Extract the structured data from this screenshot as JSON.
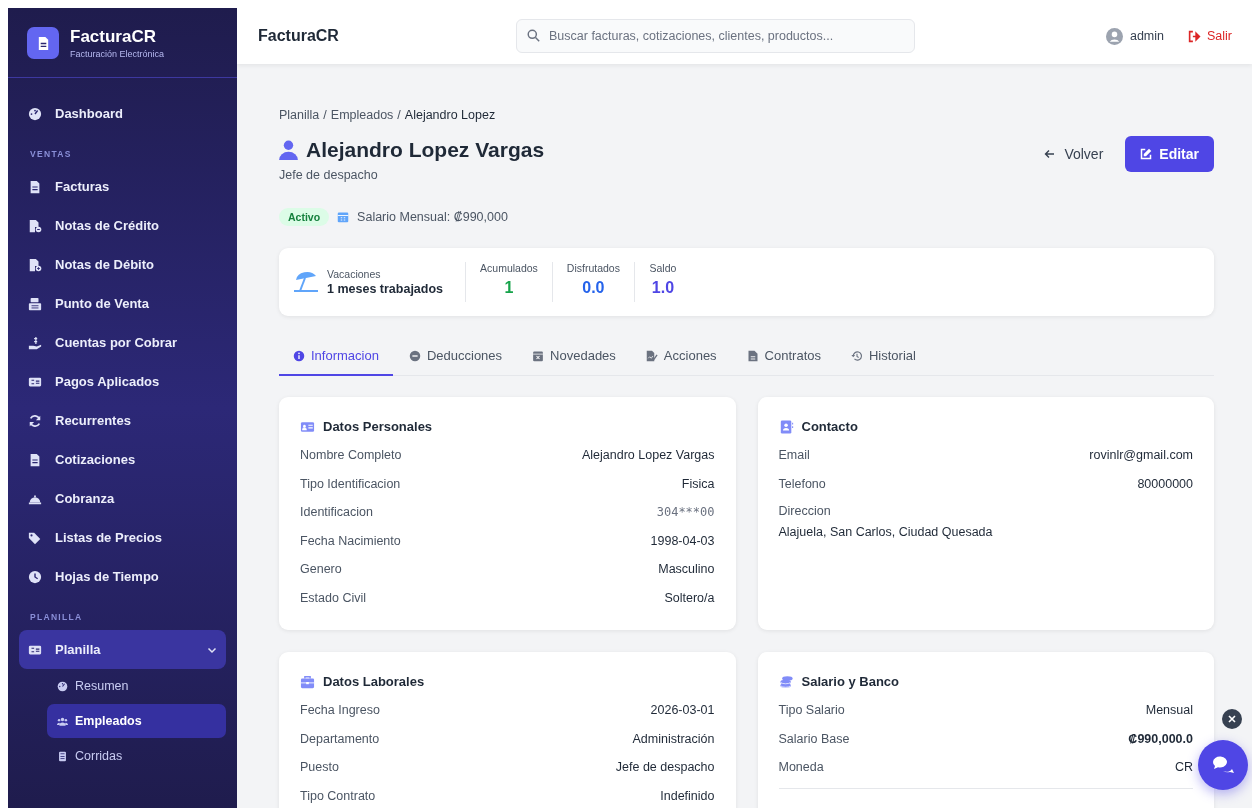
{
  "sidebar": {
    "brand_name": "FacturaCR",
    "brand_subtitle": "Facturación Electrónica",
    "items": [
      {
        "kind": "item",
        "label": "Dashboard",
        "selected": false
      },
      {
        "kind": "section",
        "label": "VENTAS"
      },
      {
        "kind": "item",
        "label": "Facturas",
        "selected": false
      },
      {
        "kind": "item",
        "label": "Notas de Crédito",
        "selected": false
      },
      {
        "kind": "item",
        "label": "Notas de Débito",
        "selected": false
      },
      {
        "kind": "item",
        "label": "Punto de Venta",
        "selected": false
      },
      {
        "kind": "item",
        "label": "Cuentas por Cobrar",
        "selected": false
      },
      {
        "kind": "item",
        "label": "Pagos Aplicados",
        "selected": false
      },
      {
        "kind": "item",
        "label": "Recurrentes",
        "selected": false
      },
      {
        "kind": "item",
        "label": "Cotizaciones",
        "selected": false
      },
      {
        "kind": "item",
        "label": "Cobranza",
        "selected": false
      },
      {
        "kind": "item",
        "label": "Listas de Precios",
        "selected": false
      },
      {
        "kind": "item",
        "label": "Hojas de Tiempo",
        "selected": false
      },
      {
        "kind": "section",
        "label": "PLANILLA"
      },
      {
        "kind": "group",
        "label": "Planilla",
        "selected": true,
        "expanded": true,
        "children": [
          {
            "label": "Resumen",
            "selected": false
          },
          {
            "label": "Empleados",
            "selected": true
          },
          {
            "label": "Corridas",
            "selected": false
          }
        ]
      }
    ]
  },
  "topbar": {
    "title": "FacturaCR",
    "search": {
      "placeholder": "Buscar facturas, cotizaciones, clientes, productos..."
    },
    "user": "admin",
    "logout": "Salir"
  },
  "breadcrumb": {
    "separator": "/",
    "items": [
      "Planilla",
      "Empleados",
      "Alejandro Lopez"
    ]
  },
  "employee": {
    "name": "Alejandro Lopez Vargas",
    "position": "Jefe de despacho",
    "status": "Activo",
    "salary": "Salario Mensual: ₡990,000"
  },
  "actions": {
    "back": "Volver",
    "edit": "Editar"
  },
  "vacations": {
    "label": "Vacaciones",
    "value": "1 meses trabajados",
    "stats": [
      {
        "label": "Acumulados",
        "value": "1",
        "color": "#16a34a"
      },
      {
        "label": "Disfrutados",
        "value": "0.0",
        "color": "#2563eb"
      },
      {
        "label": "Saldo",
        "value": "1.0",
        "color": "#4f46e5"
      }
    ]
  },
  "tabs": [
    {
      "label": "Informacion",
      "selected": true
    },
    {
      "label": "Deducciones",
      "selected": false
    },
    {
      "label": "Novedades",
      "selected": false
    },
    {
      "label": "Acciones",
      "selected": false
    },
    {
      "label": "Contratos",
      "selected": false
    },
    {
      "label": "Historial",
      "selected": false
    }
  ],
  "cards": [
    {
      "title": "Datos Personales",
      "rows": [
        {
          "kind": "text",
          "label": "Nombre Completo",
          "value": "Alejandro Lopez Vargas"
        },
        {
          "kind": "text",
          "label": "Tipo Identificacion",
          "value": "Fisica"
        },
        {
          "kind": "mono",
          "label": "Identificacion",
          "value": "304***00"
        },
        {
          "kind": "text",
          "label": "Fecha Nacimiento",
          "value": "1998-04-03"
        },
        {
          "kind": "text",
          "label": "Genero",
          "value": "Masculino"
        },
        {
          "kind": "text",
          "label": "Estado Civil",
          "value": "Soltero/a"
        }
      ]
    },
    {
      "title": "Contacto",
      "rows": [
        {
          "kind": "text",
          "label": "Email",
          "value": "rovinlr@gmail.com"
        },
        {
          "kind": "text",
          "label": "Telefono",
          "value": "80000000"
        },
        {
          "kind": "stacked",
          "label": "Direccion",
          "value": "Alajuela, San Carlos, Ciudad Quesada"
        }
      ]
    },
    {
      "title": "Datos Laborales",
      "rows": [
        {
          "kind": "text",
          "label": "Fecha Ingreso",
          "value": "2026-03-01"
        },
        {
          "kind": "text",
          "label": "Departamento",
          "value": "Administración"
        },
        {
          "kind": "text",
          "label": "Puesto",
          "value": "Jefe de despacho"
        },
        {
          "kind": "text",
          "label": "Tipo Contrato",
          "value": "Indefinido"
        }
      ]
    },
    {
      "title": "Salario y Banco",
      "rows": [
        {
          "kind": "text",
          "label": "Tipo Salario",
          "value": "Mensual"
        },
        {
          "kind": "bold",
          "label": "Salario Base",
          "value": "₡990,000.0"
        },
        {
          "kind": "text",
          "label": "Moneda",
          "value": "CR"
        },
        {
          "kind": "divider"
        }
      ]
    }
  ]
}
